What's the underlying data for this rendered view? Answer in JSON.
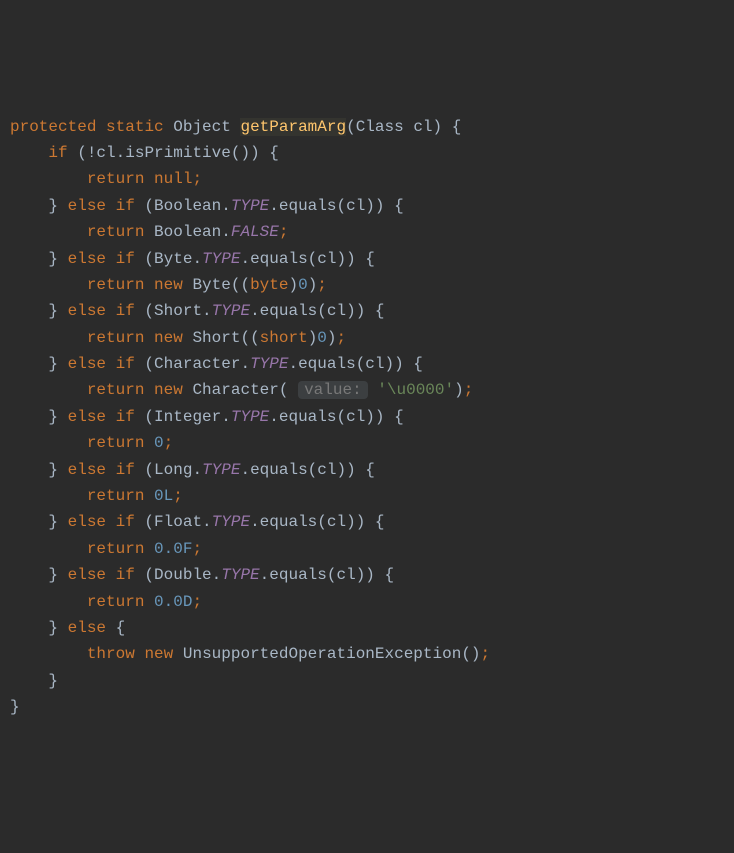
{
  "kw": {
    "protected": "protected",
    "static": "static",
    "if": "if",
    "else": "else",
    "return": "return",
    "new": "new",
    "throw": "throw",
    "null": "null"
  },
  "types": {
    "Object": "Object",
    "Class": "Class",
    "Boolean": "Boolean",
    "Byte": "Byte",
    "Short": "Short",
    "Character": "Character",
    "Integer": "Integer",
    "Long": "Long",
    "Float": "Float",
    "Double": "Double",
    "UnsupportedOperationException": "UnsupportedOperationException"
  },
  "idents": {
    "cl": "cl",
    "getParamArg": "getParamArg",
    "isPrimitive": "isPrimitive",
    "equals": "equals",
    "TYPE": "TYPE",
    "FALSE": "FALSE"
  },
  "casts": {
    "byte": "byte",
    "short": "short"
  },
  "nums": {
    "zero": "0",
    "zeroL": "0L",
    "zeroF": "0.0F",
    "zeroD": "0.0D"
  },
  "strs": {
    "u0000": "'\\u0000'"
  },
  "hints": {
    "value": "value:"
  }
}
